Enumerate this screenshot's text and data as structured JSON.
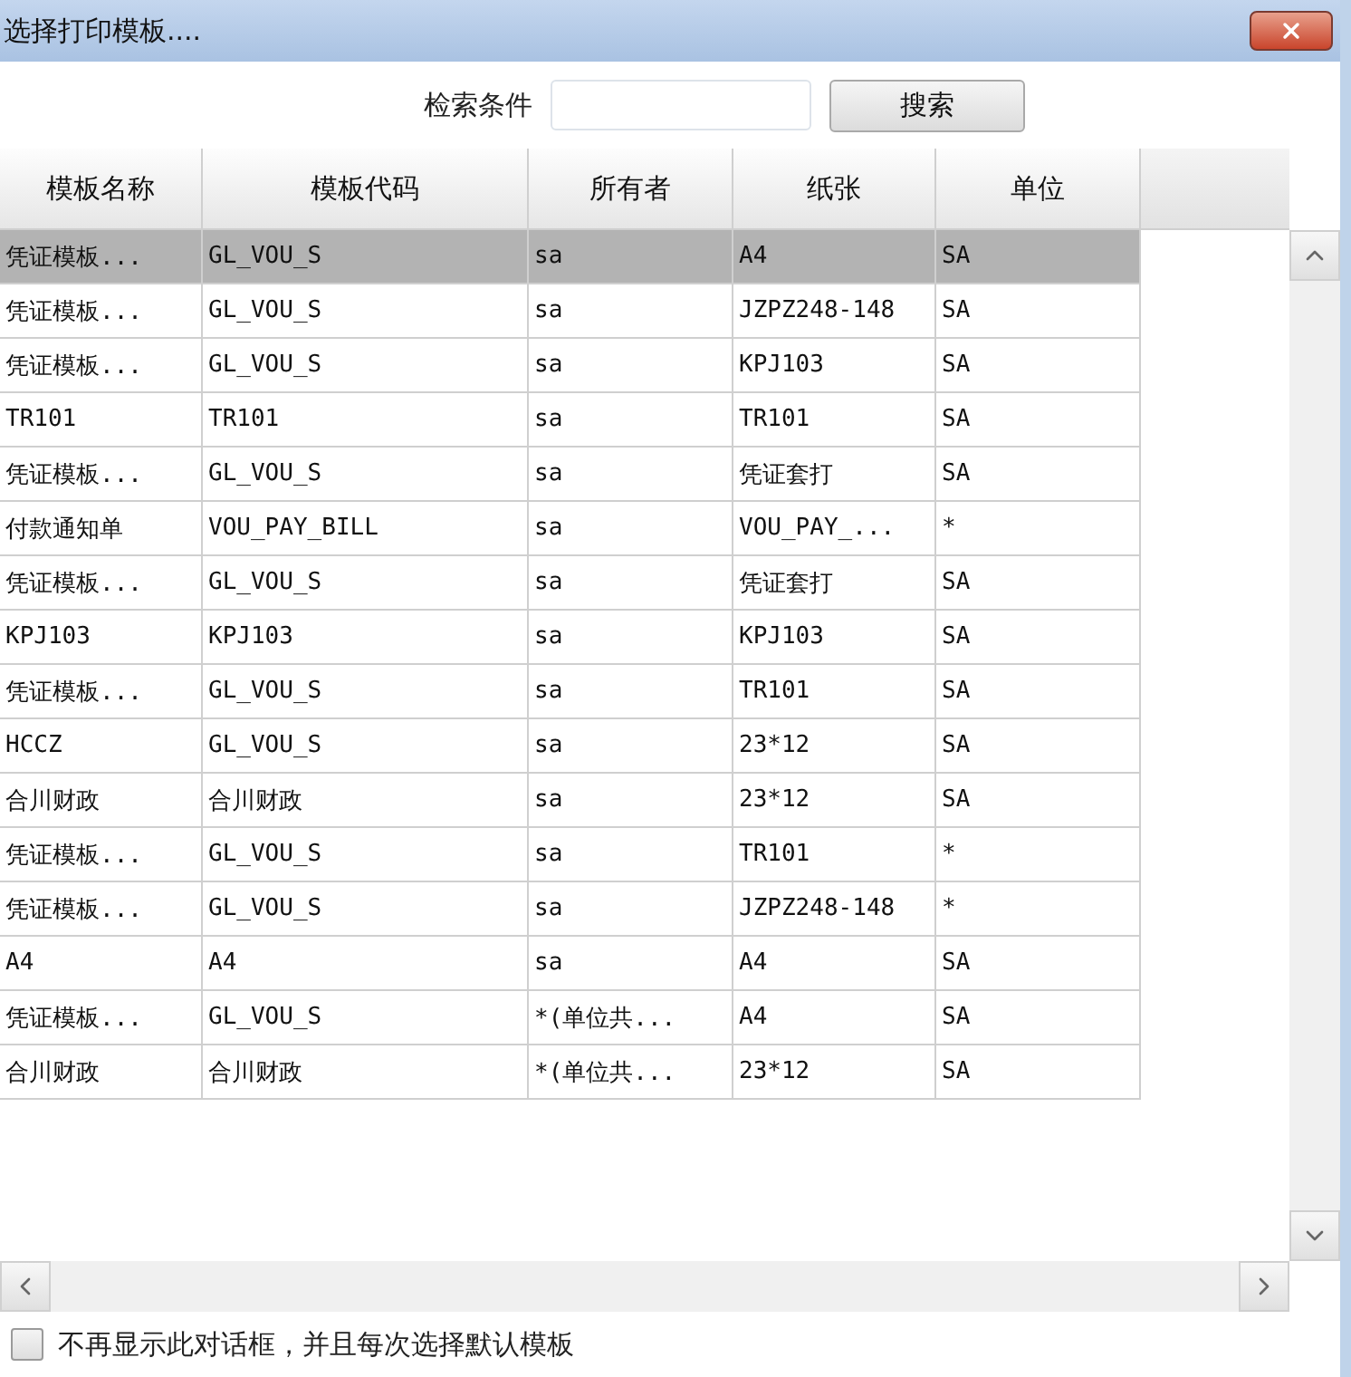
{
  "window": {
    "title": "选择打印模板...."
  },
  "search": {
    "label": "检索条件",
    "button": "搜索"
  },
  "table": {
    "columns": [
      "模板名称",
      "模板代码",
      "所有者",
      "纸张",
      "单位"
    ],
    "rows": [
      {
        "cells": [
          "凭证模板...",
          "GL_VOU_S",
          "sa",
          "A4",
          "SA"
        ],
        "selected": true
      },
      {
        "cells": [
          "凭证模板...",
          "GL_VOU_S",
          "sa",
          "JZPZ248-148",
          "SA"
        ],
        "selected": false
      },
      {
        "cells": [
          "凭证模板...",
          "GL_VOU_S",
          "sa",
          "KPJ103",
          "SA"
        ],
        "selected": false
      },
      {
        "cells": [
          "TR101",
          "TR101",
          "sa",
          "TR101",
          "SA"
        ],
        "selected": false
      },
      {
        "cells": [
          "凭证模板...",
          "GL_VOU_S",
          "sa",
          "凭证套打",
          "SA"
        ],
        "selected": false
      },
      {
        "cells": [
          "付款通知单",
          "VOU_PAY_BILL",
          "sa",
          "VOU_PAY_...",
          "*"
        ],
        "selected": false
      },
      {
        "cells": [
          "凭证模板...",
          "GL_VOU_S",
          "sa",
          "凭证套打",
          "SA"
        ],
        "selected": false
      },
      {
        "cells": [
          "KPJ103",
          "KPJ103",
          "sa",
          "KPJ103",
          "SA"
        ],
        "selected": false
      },
      {
        "cells": [
          "凭证模板...",
          "GL_VOU_S",
          "sa",
          "TR101",
          "SA"
        ],
        "selected": false
      },
      {
        "cells": [
          "HCCZ",
          "GL_VOU_S",
          "sa",
          "23*12",
          "SA"
        ],
        "selected": false
      },
      {
        "cells": [
          "合川财政",
          "合川财政",
          "sa",
          "23*12",
          "SA"
        ],
        "selected": false
      },
      {
        "cells": [
          "凭证模板...",
          "GL_VOU_S",
          "sa",
          "TR101",
          "*"
        ],
        "selected": false
      },
      {
        "cells": [
          "凭证模板...",
          "GL_VOU_S",
          "sa",
          "JZPZ248-148",
          "*"
        ],
        "selected": false
      },
      {
        "cells": [
          "A4",
          "A4",
          "sa",
          "A4",
          "SA"
        ],
        "selected": false
      },
      {
        "cells": [
          "凭证模板...",
          "GL_VOU_S",
          "*(单位共...",
          "A4",
          "SA"
        ],
        "selected": false
      },
      {
        "cells": [
          "合川财政",
          "合川财政",
          "*(单位共...",
          "23*12",
          "SA"
        ],
        "selected": false
      }
    ]
  },
  "footer": {
    "checkbox_label": "不再显示此对话框，并且每次选择默认模板",
    "checked": false
  }
}
